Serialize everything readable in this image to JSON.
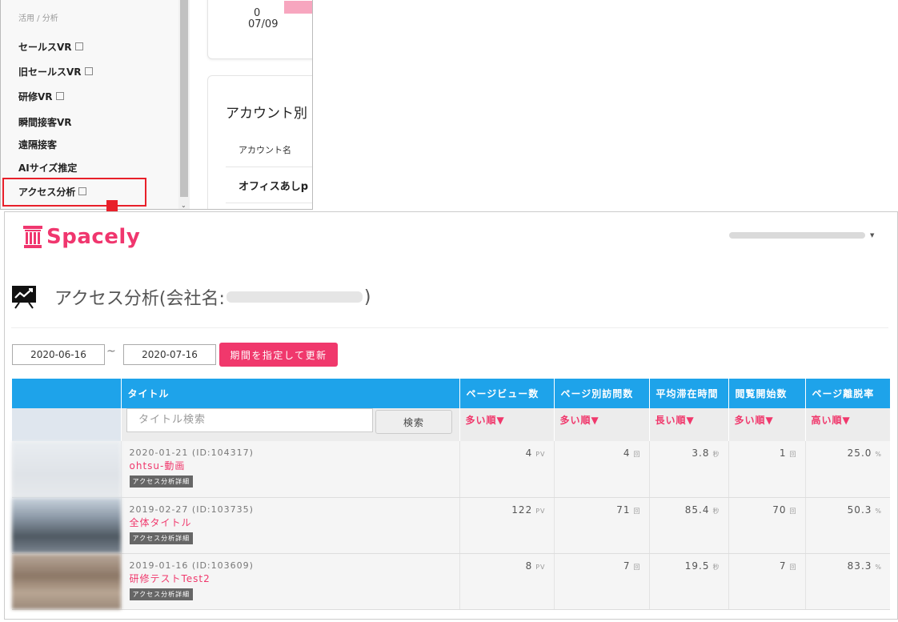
{
  "top": {
    "section_label": "活用 / 分析",
    "menu_items": [
      {
        "label": "セールスVR",
        "external": true
      },
      {
        "label": "旧セールスVR",
        "external": true
      },
      {
        "label": "研修VR",
        "external": true
      },
      {
        "label": "瞬間接客VR",
        "external": false
      },
      {
        "label": "遠隔接客",
        "external": false
      },
      {
        "label": "AIサイズ推定",
        "external": false
      },
      {
        "label": "アクセス分析",
        "external": true
      }
    ],
    "card_value": "0",
    "card_date": "07/09",
    "account_heading": "アカウント別",
    "account_column": "アカウント名",
    "account_row": "オフィスあしp"
  },
  "colors": {
    "accent": "#f0386c",
    "header": "#1ea3ea",
    "highlight": "#e8202a"
  },
  "main": {
    "logo_text": "Spacely",
    "page_title_prefix": "アクセス分析(会社名:",
    "page_title_suffix": ")",
    "date_from": "2020-06-16",
    "tilde": "~",
    "date_to": "2020-07-16",
    "update_button": "期間を指定して更新",
    "search_placeholder": "タイトル検索",
    "search_button": "検索",
    "columns": [
      "タイトル",
      "ページビュー数",
      "ページ別訪問数",
      "平均滞在時間",
      "閲覧開始数",
      "ページ離脱率"
    ],
    "sorts": [
      "多い順▼",
      "多い順▼",
      "長い順▼",
      "多い順▼",
      "高い順▼"
    ],
    "rows": [
      {
        "meta": "2020-01-21 (ID:104317)",
        "title": "ohtsu-動画",
        "tag": "アクセス分析詳細",
        "pv": "4",
        "pv_unit": "PV",
        "visits": "4",
        "visits_unit": "回",
        "avg": "3.8",
        "avg_unit": "秒",
        "starts": "1",
        "starts_unit": "回",
        "exit": "25.0",
        "exit_unit": "%"
      },
      {
        "meta": "2019-02-27 (ID:103735)",
        "title": "全体タイトル",
        "tag": "アクセス分析詳細",
        "pv": "122",
        "pv_unit": "PV",
        "visits": "71",
        "visits_unit": "回",
        "avg": "85.4",
        "avg_unit": "秒",
        "starts": "70",
        "starts_unit": "回",
        "exit": "50.3",
        "exit_unit": "%"
      },
      {
        "meta": "2019-01-16 (ID:103609)",
        "title": "研修テストTest2",
        "tag": "アクセス分析詳細",
        "pv": "8",
        "pv_unit": "PV",
        "visits": "7",
        "visits_unit": "回",
        "avg": "19.5",
        "avg_unit": "秒",
        "starts": "7",
        "starts_unit": "回",
        "exit": "83.3",
        "exit_unit": "%"
      }
    ]
  }
}
